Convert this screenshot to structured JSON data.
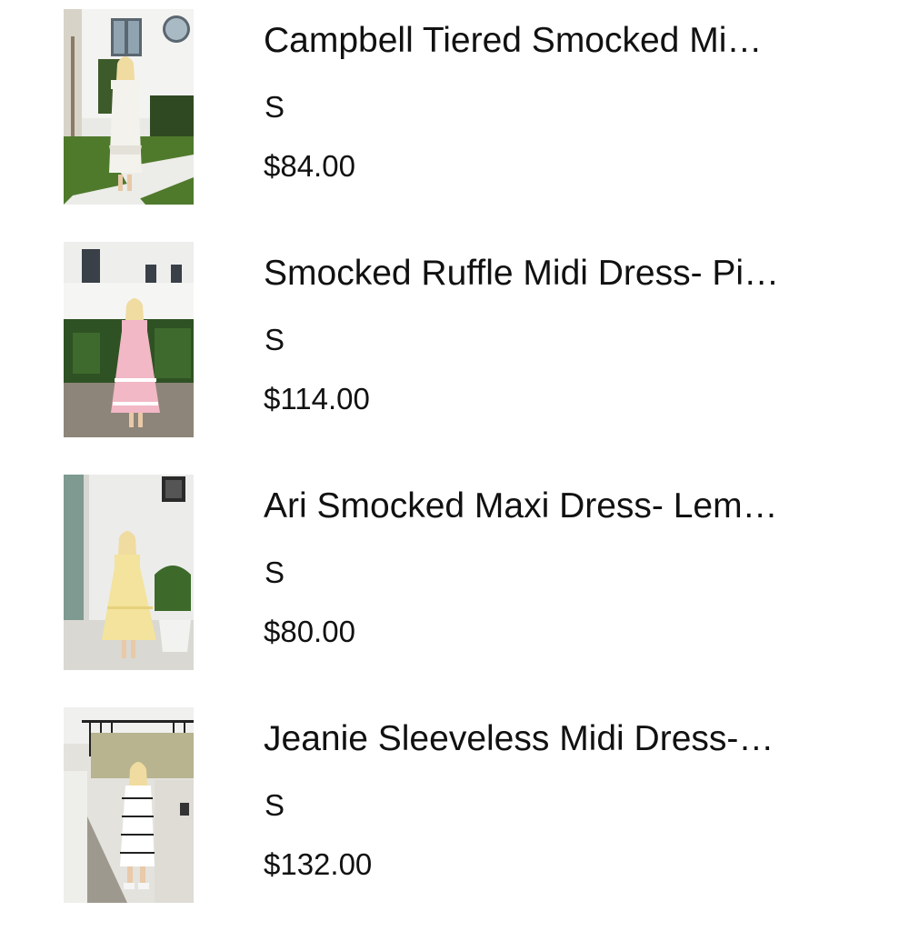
{
  "cart_items": [
    {
      "title": "Campbell Tiered Smocked Mi…",
      "size": "S",
      "price": "$84.00",
      "dress_color": "#f4f2ec"
    },
    {
      "title": "Smocked Ruffle Midi Dress- Pi…",
      "size": "S",
      "price": "$114.00",
      "dress_color": "#f2b8c6"
    },
    {
      "title": "Ari Smocked Maxi Dress- Lem…",
      "size": "S",
      "price": "$80.00",
      "dress_color": "#f3e39c"
    },
    {
      "title": "Jeanie Sleeveless Midi Dress-…",
      "size": "S",
      "price": "$132.00",
      "dress_color": "#ffffff"
    }
  ]
}
